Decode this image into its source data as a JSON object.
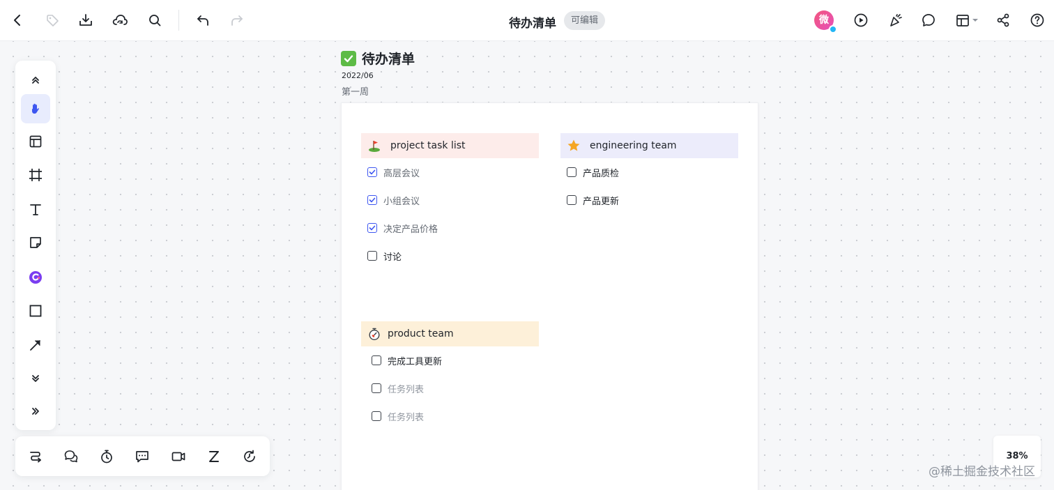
{
  "header": {
    "title": "待办清单",
    "edit_badge": "可编辑",
    "avatar_char": "微"
  },
  "frame": {
    "title": "待办清单",
    "date": "2022/06",
    "week": "第一周"
  },
  "sections": {
    "project": {
      "title": "project task list",
      "icon": "golf-flag-icon",
      "color": "#fdecea",
      "tasks": [
        {
          "label": "高层会议",
          "checked": true
        },
        {
          "label": "小组会议",
          "checked": true
        },
        {
          "label": "决定产品价格",
          "checked": true
        },
        {
          "label": "讨论",
          "checked": false
        }
      ]
    },
    "engineering": {
      "title": "engineering  team",
      "icon": "star-icon",
      "color": "#ececfb",
      "tasks": [
        {
          "label": "产品质检",
          "checked": false
        },
        {
          "label": "产品更新",
          "checked": false
        }
      ]
    },
    "product": {
      "title": "product  team",
      "icon": "stopwatch-icon",
      "color": "#fdf0d9",
      "tasks": [
        {
          "label": "完成工具更新",
          "checked": false
        },
        {
          "label": "任务列表",
          "checked": false,
          "placeholder": true
        },
        {
          "label": "任务列表",
          "checked": false,
          "placeholder": true
        }
      ]
    }
  },
  "zoom": "38%",
  "watermark": "@稀土掘金技术社区",
  "accent_color": "#3d56f0"
}
